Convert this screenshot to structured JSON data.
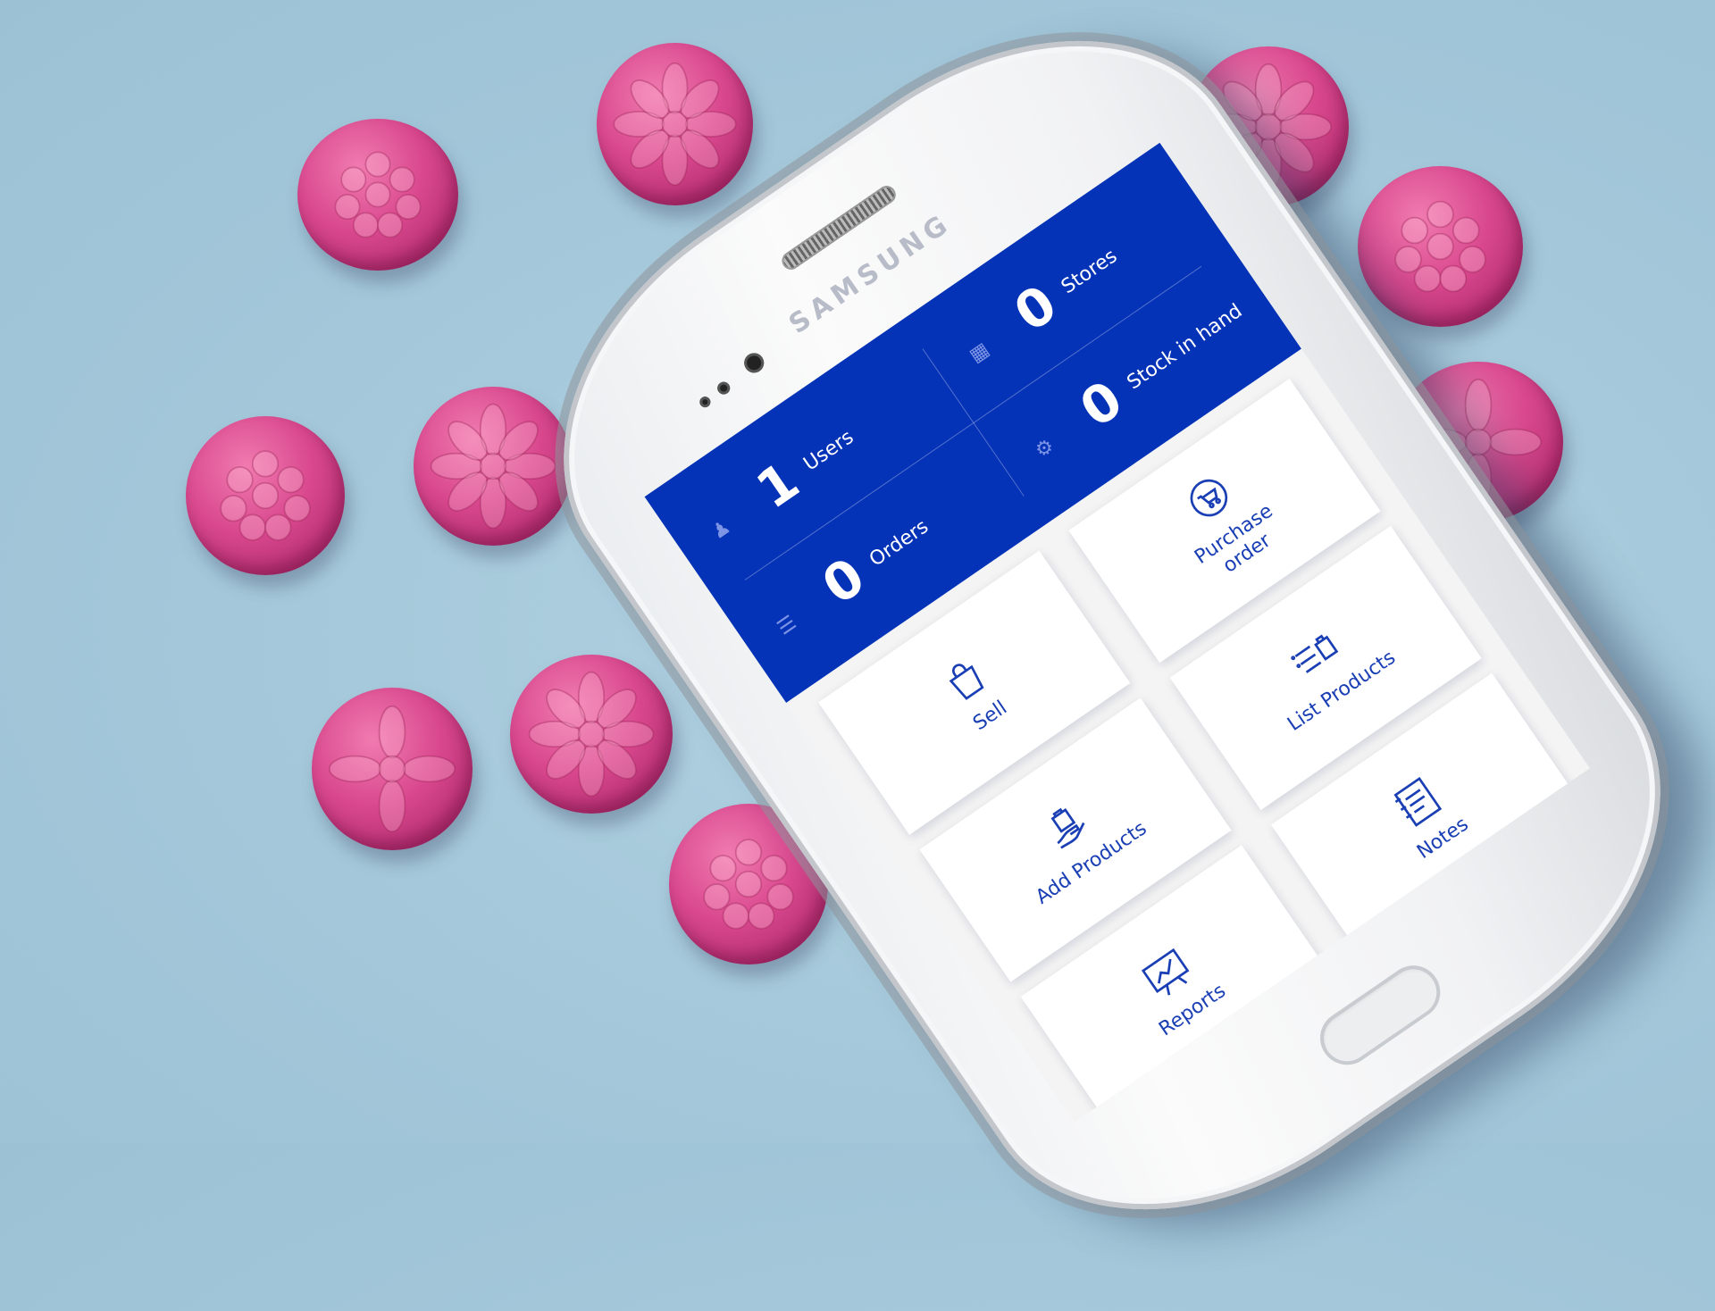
{
  "device": {
    "brand": "SAMSUNG"
  },
  "dashboard": {
    "stats": [
      {
        "value": "1",
        "label": "Users",
        "icon": "users-icon"
      },
      {
        "value": "0",
        "label": "Stores",
        "icon": "store-icon"
      },
      {
        "value": "0",
        "label": "Orders",
        "icon": "orders-list-icon"
      },
      {
        "value": "0",
        "label": "Stock in hand",
        "icon": "stock-icon"
      }
    ],
    "tiles": [
      {
        "label": "Sell",
        "icon": "shopping-bag-icon"
      },
      {
        "label": "Purchase order",
        "icon": "purchase-cart-icon"
      },
      {
        "label": "Add Products",
        "icon": "hand-bag-icon"
      },
      {
        "label": "List Products",
        "icon": "list-bag-icon"
      },
      {
        "label": "Reports",
        "icon": "chart-board-icon"
      },
      {
        "label": "Notes",
        "icon": "notebook-icon"
      }
    ]
  },
  "colors": {
    "header_blue": "#0533b8",
    "tile_text": "#1a3fb5",
    "candy_pink": "#d9488e",
    "background": "#a6c9db"
  }
}
